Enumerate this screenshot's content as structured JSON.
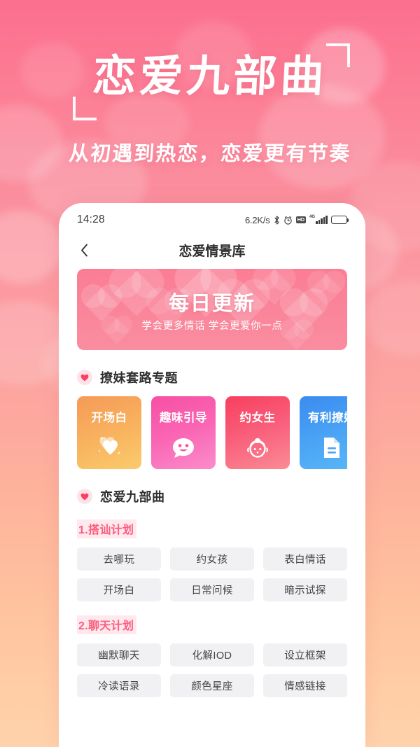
{
  "promo": {
    "title": "恋爱九部曲",
    "subtitle": "从初遇到热恋，恋爱更有节奏",
    "bg_top_color": "#fb6f8f",
    "bg_bottom_color": "#ffd2ab"
  },
  "status_bar": {
    "time": "14:28",
    "network_speed": "6.2K/s",
    "icons": [
      "bluetooth-icon",
      "alarm-icon",
      "hd-icon",
      "signal-icon",
      "battery-icon"
    ],
    "hd_label": "HD",
    "network_type": "4G"
  },
  "nav": {
    "back_icon": "chevron-left-icon",
    "title": "恋爱情景库"
  },
  "banner": {
    "title": "每日更新",
    "subtitle": "学会更多情话  学会更爱你一点",
    "bg_color": "#fa8499"
  },
  "sections": [
    {
      "heart_icon": "heart-icon",
      "title": "撩妹套路专题",
      "cards": [
        {
          "label": "开场白",
          "icon": "hearts-icon",
          "color_start": "#f59a57",
          "color_end": "#fbc96c"
        },
        {
          "label": "趣味引导",
          "icon": "smiley-chat-icon",
          "color_start": "#f95aa8",
          "color_end": "#fb86c6"
        },
        {
          "label": "约女生",
          "icon": "girl-face-icon",
          "color_start": "#f8405f",
          "color_end": "#fb8591"
        },
        {
          "label": "有利撩妹",
          "icon": "document-icon",
          "color_start": "#3f8ff0",
          "color_end": "#57b4f7"
        }
      ]
    },
    {
      "heart_icon": "heart-icon",
      "title": "恋爱九部曲",
      "groups": [
        {
          "label": "1.搭讪计划",
          "tags": [
            "去哪玩",
            "约女孩",
            "表白情话",
            "开场白",
            "日常问候",
            "暗示试探"
          ]
        },
        {
          "label": "2.聊天计划",
          "tags": [
            "幽默聊天",
            "化解IOD",
            "设立框架",
            "冷读语录",
            "颜色星座",
            "情感链接"
          ]
        }
      ]
    }
  ]
}
